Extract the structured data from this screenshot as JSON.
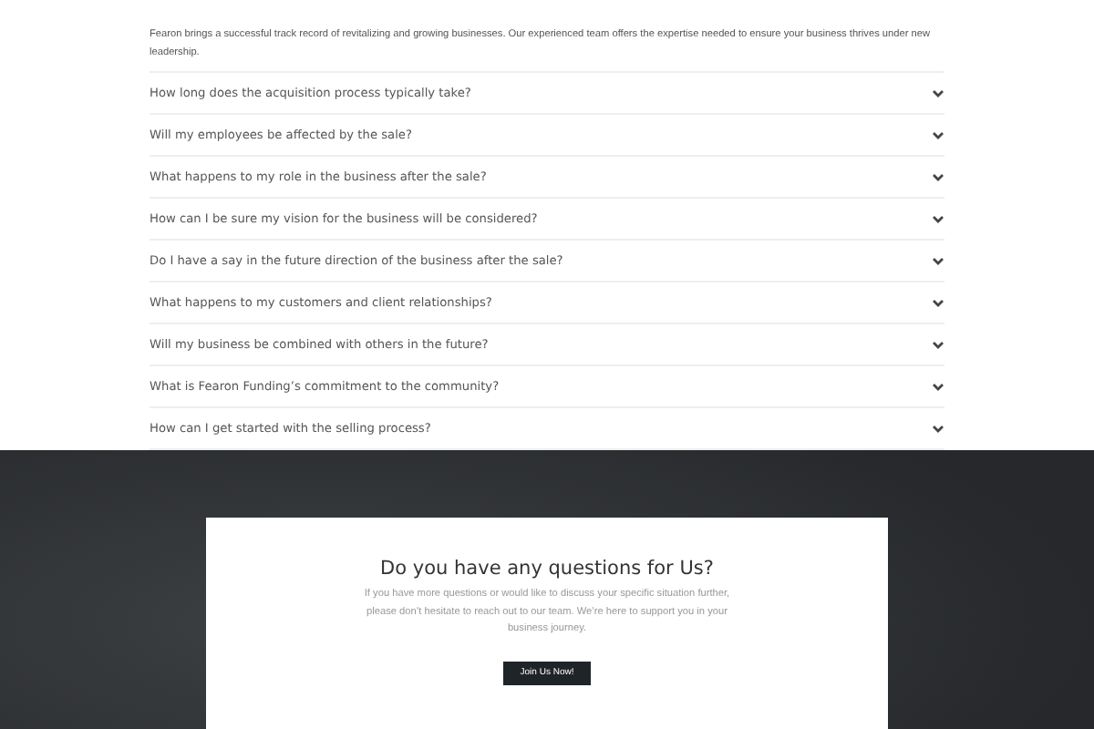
{
  "intro": "Fearon brings a successful track record of revitalizing and growing businesses. Our experienced team offers the expertise needed to ensure your business thrives under new leadership.",
  "faq": [
    {
      "question": "How long does the acquisition process typically take?",
      "expanded": false
    },
    {
      "question": "Will my employees be affected by the sale?",
      "expanded": false
    },
    {
      "question": "What happens to my role in the business after the sale?",
      "expanded": false
    },
    {
      "question": "How can I be sure my vision for the business will be considered?",
      "expanded": false
    },
    {
      "question": "Do I have a say in the future direction of the business after the sale?",
      "expanded": false
    },
    {
      "question": "What happens to my customers and client relationships?",
      "expanded": false
    },
    {
      "question": "Will my business be combined with others in the future?",
      "expanded": false
    },
    {
      "question": "What is Fearon Funding’s commitment to the community?",
      "expanded": false
    },
    {
      "question": "How can I get started with the selling process?",
      "expanded": false
    }
  ],
  "contact": {
    "title": "Do you have any questions for Us?",
    "text": "If you have more questions or would like to discuss your specific situation further, please don’t hesitate to reach out to our team. We’re here to support you in your business journey.",
    "button": "Join Us Now!"
  }
}
